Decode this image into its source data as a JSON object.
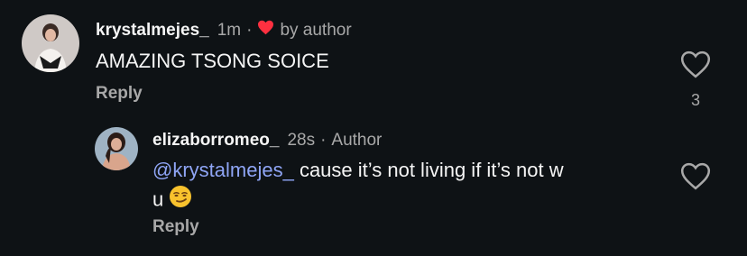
{
  "comment": {
    "username": "krystalmejes_",
    "time": "1m",
    "separator": "·",
    "liked_by_author_label": "by author",
    "text": "AMAZING TSONG SOICE",
    "reply_label": "Reply",
    "like_count": "3",
    "heart_color": "#ff3040"
  },
  "reply": {
    "username": "elizaborromeo_",
    "time": "28s",
    "separator": "·",
    "author_badge": "Author",
    "mention": "@krystalmejes_",
    "text_line1": " cause it’s not living if it’s not w",
    "text_line2": "u",
    "emoji": "smirking-face-emoji",
    "reply_label": "Reply"
  },
  "colors": {
    "background": "#0e1215",
    "mention": "#8fa5f5",
    "secondary_text": "#a8a8a8"
  }
}
